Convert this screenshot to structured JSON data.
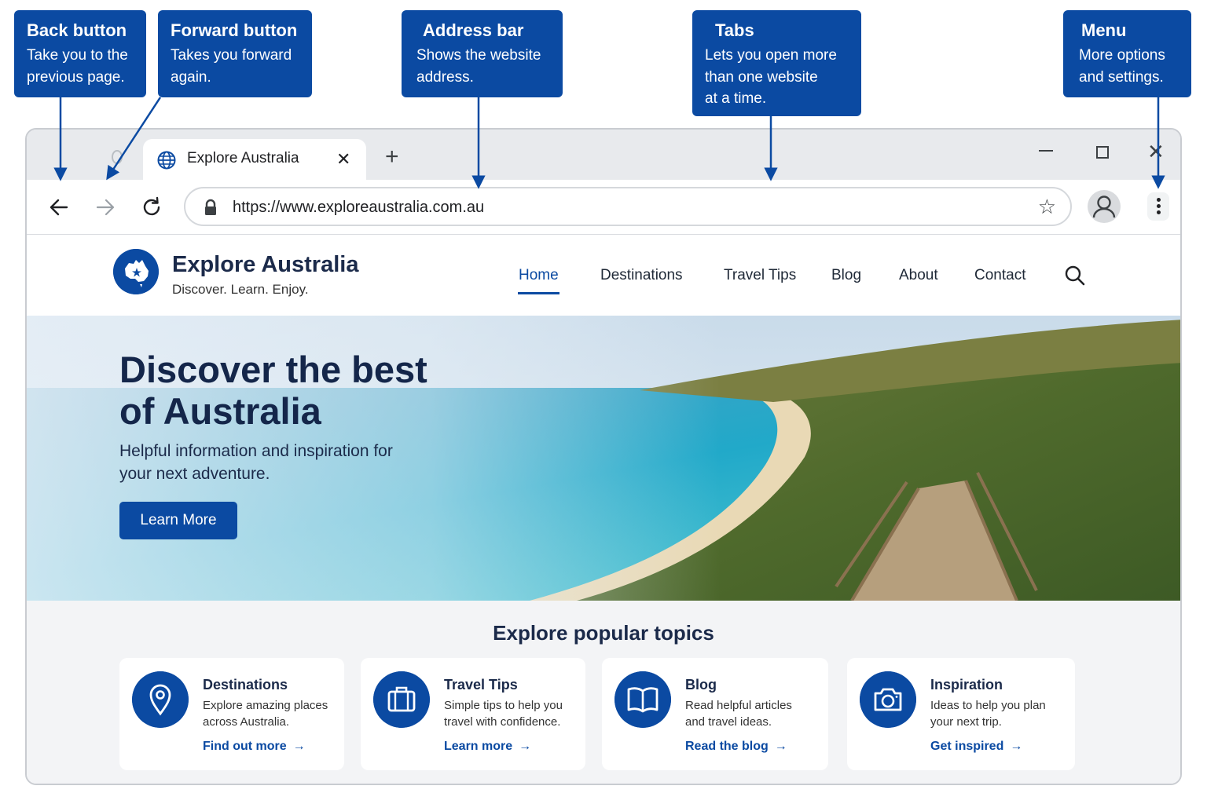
{
  "callouts": [
    {
      "title": "Back button",
      "line1": "Take you to the",
      "line2": "previous page.",
      "line3": ""
    },
    {
      "title": "Forward button",
      "line1": "Takes you forward",
      "line2": "again.",
      "line3": ""
    },
    {
      "title": "Address bar",
      "line1": "Shows the website",
      "line2": "address.",
      "line3": ""
    },
    {
      "title": "Tabs",
      "line1": "Lets you open more",
      "line2": "than one website",
      "line3": "at a time."
    },
    {
      "title": "Menu",
      "line1": "More options",
      "line2": "and settings.",
      "line3": ""
    }
  ],
  "browser": {
    "tab_title": "Explore Australia",
    "tab_close": "✕",
    "new_tab": "+",
    "url": "https://www.exploreaustralia.com.au",
    "star": "☆",
    "window_close": "✕"
  },
  "site": {
    "brand_name": "Explore Australia",
    "tagline": "Discover. Learn. Enjoy.",
    "nav": [
      "Home",
      "Destinations",
      "Travel Tips",
      "Blog",
      "About",
      "Contact"
    ],
    "hero_title": "Discover the best of Australia",
    "hero_subtitle": "Helpful information and inspiration for your next adventure.",
    "hero_button": "Learn More",
    "topics_title": "Explore popular topics",
    "cards": [
      {
        "title": "Destinations",
        "desc": "Explore amazing places across Australia.",
        "link": "Find out more",
        "icon": "map-pin-icon"
      },
      {
        "title": "Travel Tips",
        "desc": "Simple tips to help you travel with confidence.",
        "link": "Learn more",
        "icon": "suitcase-icon"
      },
      {
        "title": "Blog",
        "desc": "Read helpful articles and travel ideas.",
        "link": "Read the blog",
        "icon": "book-icon"
      },
      {
        "title": "Inspiration",
        "desc": "Ideas to help you plan your next trip.",
        "link": "Get inspired",
        "icon": "camera-icon"
      }
    ],
    "arrow": "→"
  },
  "colors": {
    "brand": "#0b4aa2",
    "tabstrip": "#e8eaed",
    "topics_bg": "#f3f4f6"
  }
}
